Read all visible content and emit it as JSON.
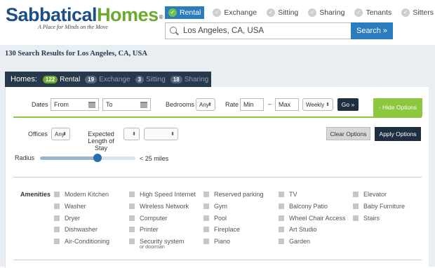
{
  "brand": {
    "name_part1": "Sabbatical",
    "name_part2": "Homes",
    "registered": "®",
    "tagline": "A Place for Minds on the Move"
  },
  "listing_types": [
    {
      "label": "Rental",
      "active": true
    },
    {
      "label": "Exchange",
      "active": false
    },
    {
      "label": "Sitting",
      "active": false
    },
    {
      "label": "Sharing",
      "active": false
    },
    {
      "label": "Tenants",
      "active": false
    },
    {
      "label": "Sitters",
      "active": false
    }
  ],
  "search": {
    "value": "Los Angeles, CA, USA",
    "button": "Search »"
  },
  "results_title": "130 Search Results for Los Angeles, CA, USA",
  "tabs": {
    "homes_label": "Homes:",
    "items": [
      {
        "count": "122",
        "label": "Rental",
        "active": true
      },
      {
        "count": "19",
        "label": "Exchange",
        "active": false
      },
      {
        "count": "3",
        "label": "Sitting",
        "active": false
      },
      {
        "count": "18",
        "label": "Sharing",
        "active": false
      }
    ]
  },
  "filters": {
    "dates_label": "Dates",
    "from_value": "From",
    "to_value": "To",
    "bedrooms_label": "Bedrooms",
    "bedrooms_value": "Any",
    "rate_label": "Rate",
    "min_value": "Min",
    "dash": "–",
    "max_value": "Max",
    "period_value": "Weekly",
    "go_button": "Go »",
    "hide_options": "- Hide Options",
    "offices_label": "Offices",
    "offices_value": "Any",
    "stay_label": "Expected Length of Stay",
    "clear_button": "Clear Options",
    "apply_button": "Apply Options",
    "radius_label": "Radius",
    "radius_value": "< 25 miles",
    "radius_level": 0.62
  },
  "amenities": {
    "label": "Amenities",
    "columns": [
      [
        "Modern Kitchen",
        "Washer",
        "Dryer",
        "Dishwasher",
        "Air-Conditioning"
      ],
      [
        "High Speed Internet",
        "Wireless Network",
        "Computer",
        "Printer",
        "Security system"
      ],
      [
        "Reserved parking",
        "Gym",
        "Pool",
        "Fireplace",
        "Piano"
      ],
      [
        "TV",
        "Balcony Patio",
        "Wheel Chair Access",
        "Art Studio",
        "Garden"
      ],
      [
        "Elevator",
        "Baby Furniture",
        "Stairs"
      ]
    ],
    "security_sub": "or doorman"
  }
}
